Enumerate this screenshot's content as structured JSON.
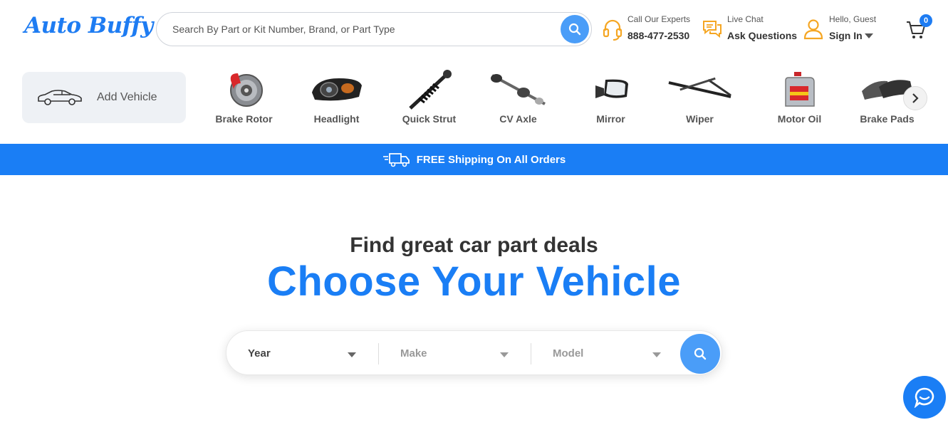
{
  "brand": {
    "logo_text": "Auto Buffy",
    "accent": "#1a7ef5"
  },
  "search": {
    "placeholder": "Search By Part or Kit Number, Brand, or Part Type"
  },
  "header": {
    "call_small": "Call Our Experts",
    "call_big": "888-477-2530",
    "chat_small": "Live Chat",
    "chat_big": "Ask Questions",
    "account_small": "Hello, Guest",
    "account_big": "Sign In",
    "cart_count": "0"
  },
  "add_vehicle": {
    "label": "Add Vehicle"
  },
  "categories": [
    {
      "label": "Brake Rotor",
      "icon": "brake-rotor-icon"
    },
    {
      "label": "Headlight",
      "icon": "headlight-icon"
    },
    {
      "label": "Quick Strut",
      "icon": "strut-icon"
    },
    {
      "label": "CV Axle",
      "icon": "cv-axle-icon"
    },
    {
      "label": "Mirror",
      "icon": "mirror-icon"
    },
    {
      "label": "Wiper",
      "icon": "wiper-icon"
    },
    {
      "label": "Motor Oil",
      "icon": "motor-oil-icon"
    },
    {
      "label": "Brake Pads",
      "icon": "brake-pads-icon"
    }
  ],
  "banner": {
    "text": "FREE Shipping On All Orders"
  },
  "hero": {
    "subtitle": "Find great car part deals",
    "title": "Choose Your Vehicle"
  },
  "vehicle_selector": {
    "year": "Year",
    "make": "Make",
    "model": "Model"
  }
}
